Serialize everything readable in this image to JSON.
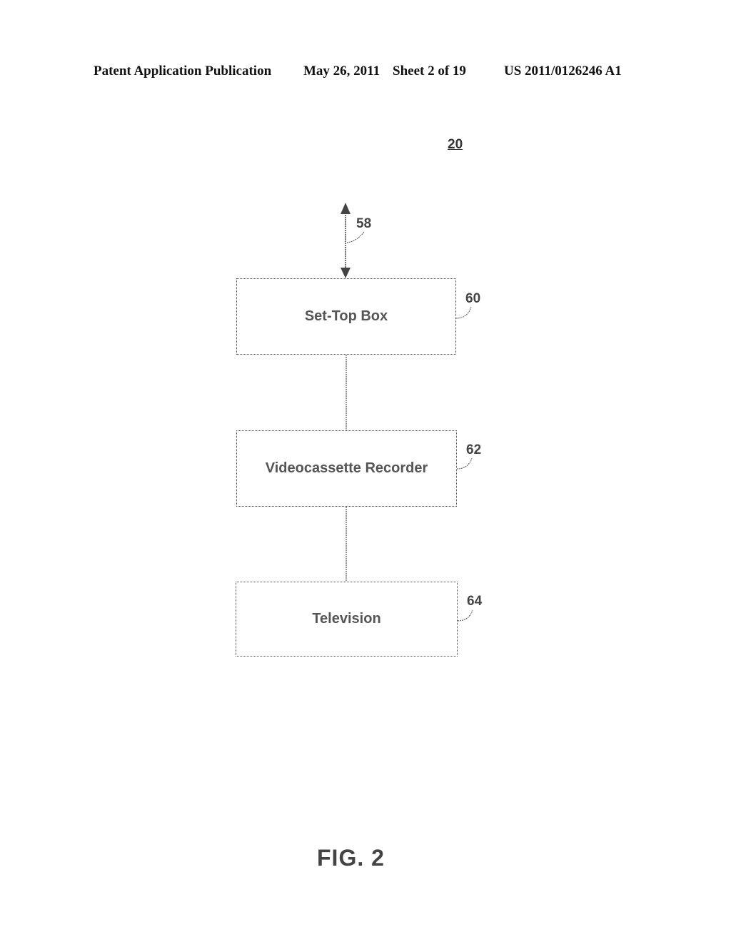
{
  "header": {
    "publication_type": "Patent Application Publication",
    "date": "May 26, 2011",
    "sheet": "Sheet 2 of 19",
    "publication_number": "US 2011/0126246 A1"
  },
  "figure_reference": "20",
  "signal_reference": "58",
  "blocks": [
    {
      "label": "Set-Top Box",
      "ref": "60"
    },
    {
      "label": "Videocassette Recorder",
      "ref": "62"
    },
    {
      "label": "Television",
      "ref": "64"
    }
  ],
  "figure_label": "FIG. 2"
}
